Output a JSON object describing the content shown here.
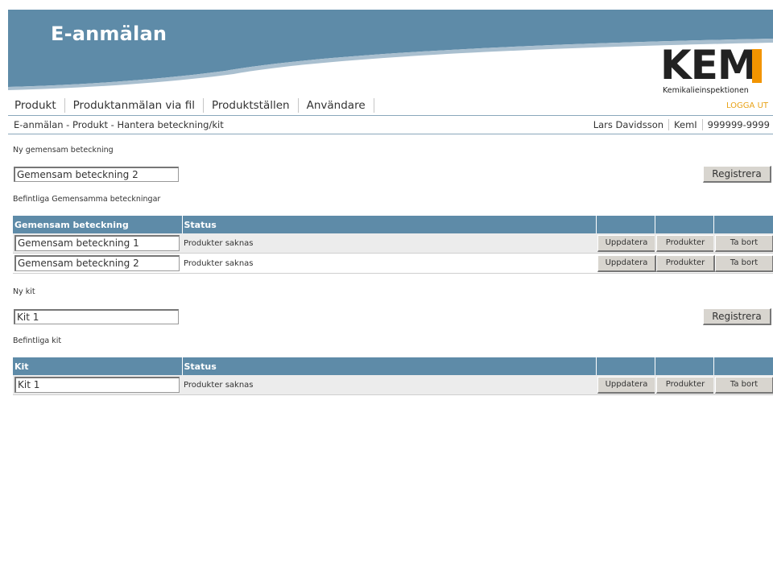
{
  "header": {
    "app_title": "E-anmälan",
    "logo_text": "KEM",
    "logo_sub": "Kemikalieinspektionen",
    "colors": {
      "banner": "#5e8ba8",
      "accent": "#f29400"
    }
  },
  "nav": {
    "items": [
      "Produkt",
      "Produktanmälan via fil",
      "Produktställen",
      "Användare"
    ],
    "logout": "LOGGA UT"
  },
  "breadcrumb": "E-anmälan - Produkt - Hantera beteckning/kit",
  "user": {
    "name": "Lars Davidsson",
    "org": "KemI",
    "org_number": "999999-9999"
  },
  "new_designation": {
    "label": "Ny gemensam beteckning",
    "value": "Gemensam beteckning 2",
    "register_label": "Registrera"
  },
  "existing_designations": {
    "label": "Befintliga Gemensamma beteckningar",
    "columns": [
      "Gemensam beteckning",
      "Status"
    ],
    "rows": [
      {
        "name": "Gemensam beteckning 1",
        "status": "Produkter saknas"
      },
      {
        "name": "Gemensam beteckning 2",
        "status": "Produkter saknas"
      }
    ]
  },
  "new_kit": {
    "label": "Ny kit",
    "value": "Kit 1",
    "register_label": "Registrera"
  },
  "existing_kits": {
    "label": "Befintliga kit",
    "columns": [
      "Kit",
      "Status"
    ],
    "rows": [
      {
        "name": "Kit 1",
        "status": "Produkter saknas"
      }
    ]
  },
  "row_actions": {
    "update": "Uppdatera",
    "products": "Produkter",
    "remove": "Ta bort"
  }
}
